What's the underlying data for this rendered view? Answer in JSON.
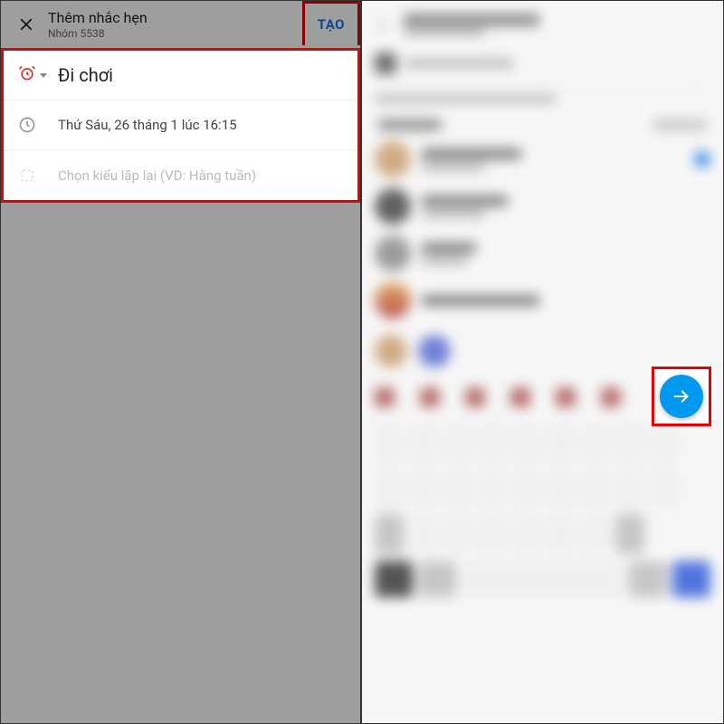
{
  "left": {
    "header": {
      "title": "Thêm nhắc hẹn",
      "subtitle": "Nhóm 5538",
      "create_label": "TẠO"
    },
    "form": {
      "event_title": "Đi chơi",
      "datetime": "Thứ Sáu, 26 tháng 1 lúc 16:15",
      "repeat_placeholder": "Chọn kiểu lặp lại (VD: Hằng tuần)"
    }
  },
  "right": {
    "fab_icon_name": "arrow-right"
  }
}
